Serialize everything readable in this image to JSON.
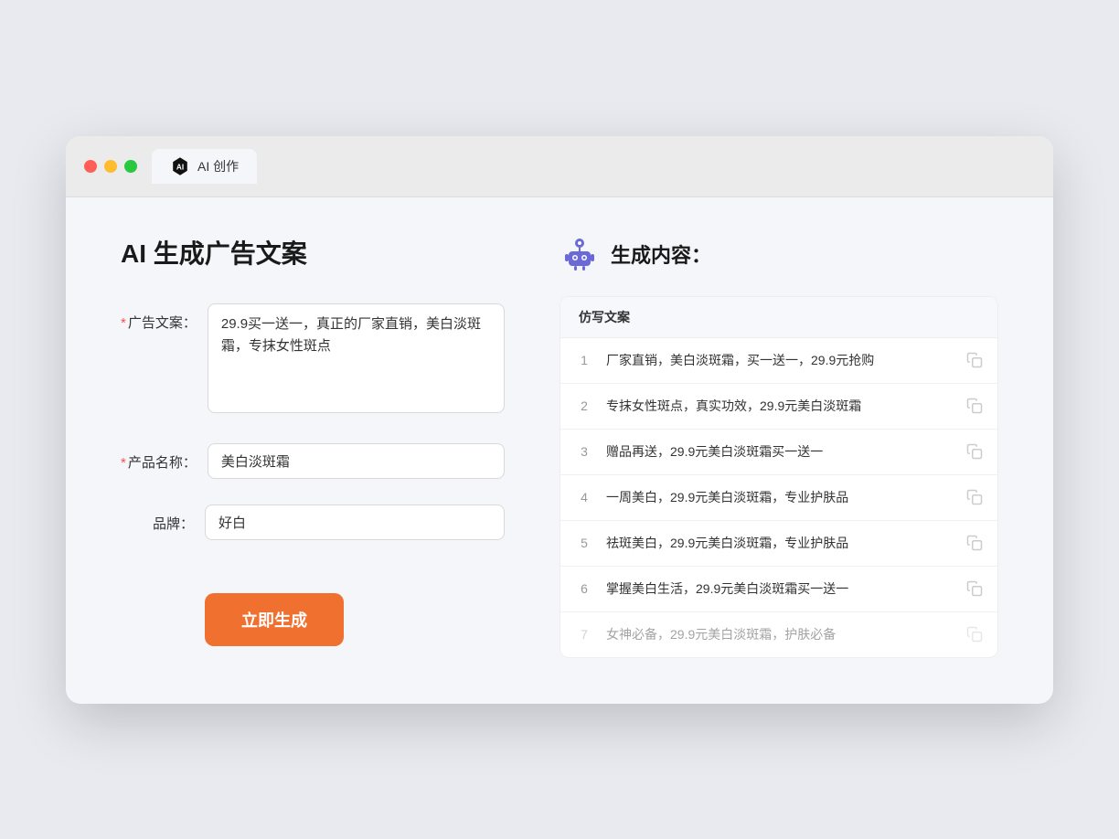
{
  "browser": {
    "tab_label": "AI 创作"
  },
  "page": {
    "title": "AI 生成广告文案",
    "form": {
      "ad_copy_label": "广告文案：",
      "ad_copy_required": true,
      "ad_copy_value": "29.9买一送一，真正的厂家直销，美白淡斑霜，专抹女性斑点",
      "product_name_label": "产品名称：",
      "product_name_required": true,
      "product_name_value": "美白淡斑霜",
      "brand_label": "品牌：",
      "brand_required": false,
      "brand_value": "好白",
      "generate_button": "立即生成"
    },
    "result": {
      "header_icon": "robot",
      "title": "生成内容：",
      "table_header": "仿写文案",
      "items": [
        {
          "num": 1,
          "text": "厂家直销，美白淡斑霜，买一送一，29.9元抢购"
        },
        {
          "num": 2,
          "text": "专抹女性斑点，真实功效，29.9元美白淡斑霜"
        },
        {
          "num": 3,
          "text": "赠品再送，29.9元美白淡斑霜买一送一"
        },
        {
          "num": 4,
          "text": "一周美白，29.9元美白淡斑霜，专业护肤品"
        },
        {
          "num": 5,
          "text": "祛斑美白，29.9元美白淡斑霜，专业护肤品"
        },
        {
          "num": 6,
          "text": "掌握美白生活，29.9元美白淡斑霜买一送一"
        },
        {
          "num": 7,
          "text": "女神必备，29.9元美白淡斑霜，护肤必备"
        }
      ]
    }
  }
}
